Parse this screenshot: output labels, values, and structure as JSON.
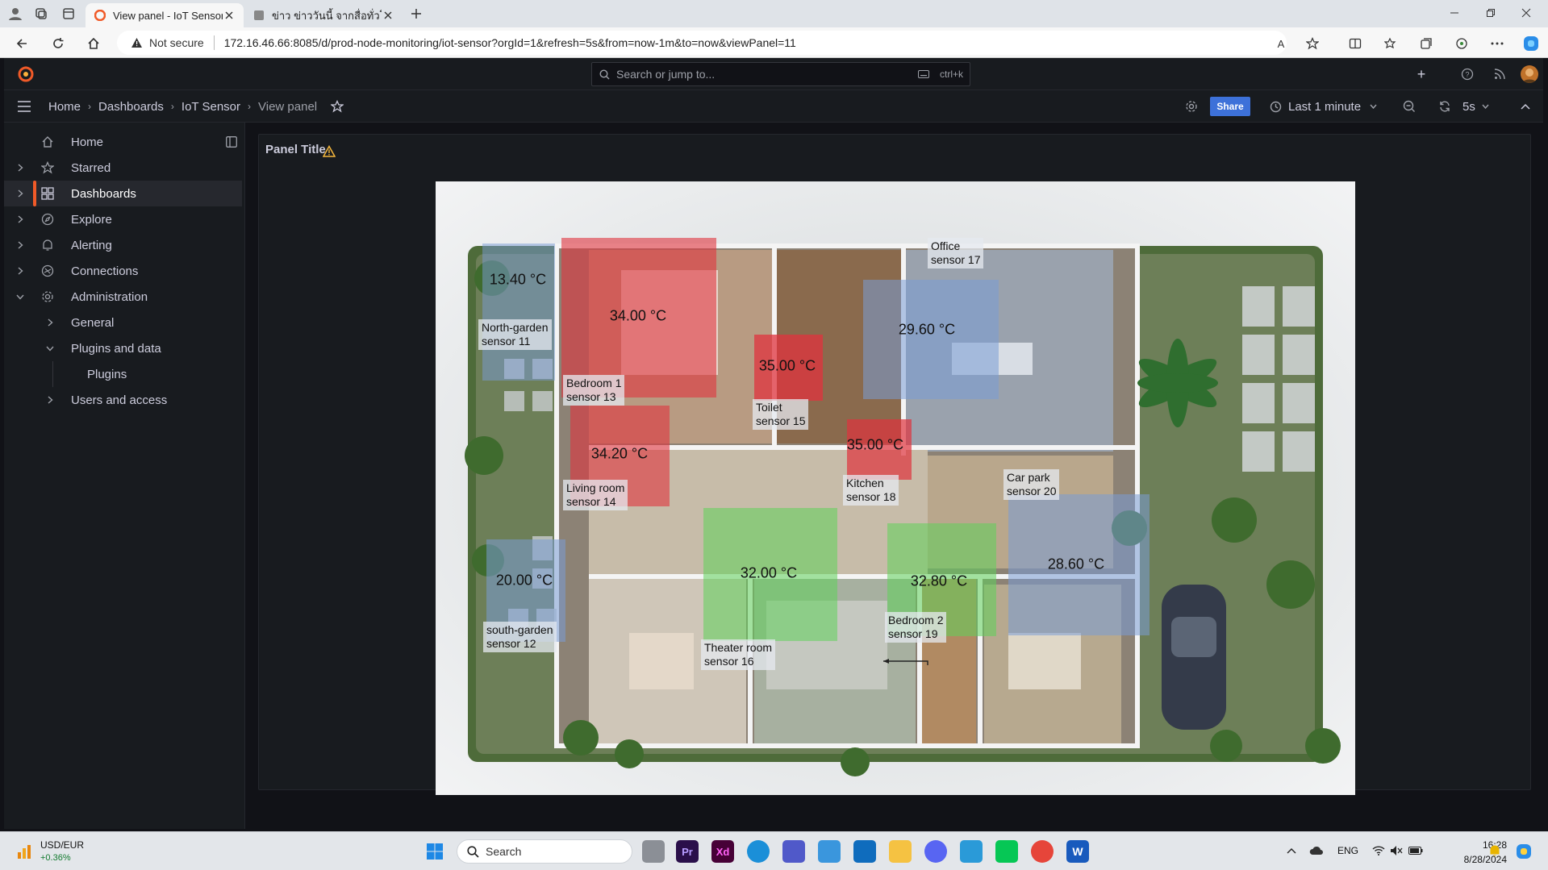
{
  "browser": {
    "tabs": [
      {
        "title": "View panel - IoT Sensor - Dashbo",
        "active": true
      },
      {
        "title": "ข่าว ข่าววันนี้ จากสื่อทั่วโลก ผลบอลโลก",
        "active": false
      }
    ],
    "security_label": "Not secure",
    "url": "172.16.46.66:8085/d/prod-node-monitoring/iot-sensor?orgId=1&refresh=5s&from=now-1m&to=now&viewPanel=11"
  },
  "grafana": {
    "search_placeholder": "Search or jump to...",
    "search_shortcut": "ctrl+k",
    "breadcrumb": [
      "Home",
      "Dashboards",
      "IoT Sensor",
      "View panel"
    ],
    "share_label": "Share",
    "time_range": "Last 1 minute",
    "refresh_interval": "5s",
    "accent": "#f05a28",
    "share_color": "#3d71d9"
  },
  "sidebar": {
    "items": [
      {
        "label": "Home",
        "icon": "home-icon"
      },
      {
        "label": "Starred",
        "icon": "star-icon"
      },
      {
        "label": "Dashboards",
        "icon": "apps-icon",
        "active": true
      },
      {
        "label": "Explore",
        "icon": "compass-icon"
      },
      {
        "label": "Alerting",
        "icon": "bell-icon"
      },
      {
        "label": "Connections",
        "icon": "connections-icon"
      },
      {
        "label": "Administration",
        "icon": "cog-icon",
        "expanded": true
      },
      {
        "label": "General"
      },
      {
        "label": "Plugins and data",
        "expanded": true
      },
      {
        "label": "Plugins"
      },
      {
        "label": "Users and access"
      }
    ]
  },
  "panel": {
    "title": "Panel Title",
    "rooms": [
      {
        "name": "North-garden",
        "sensor": "sensor 11",
        "temp": "13.40 °C",
        "color": "#7a9cd6"
      },
      {
        "name": "south-garden",
        "sensor": "sensor 12",
        "temp": "20.00 °C",
        "color": "#7a9cd6"
      },
      {
        "name": "Bedroom 1",
        "sensor": "sensor 13",
        "temp": "34.00 °C",
        "color": "#e0333d"
      },
      {
        "name": "Living room",
        "sensor": "sensor 14",
        "temp": "34.20 °C",
        "color": "#e0333d"
      },
      {
        "name": "Toilet",
        "sensor": "sensor 15",
        "temp": "35.00 °C",
        "color": "#e0333d"
      },
      {
        "name": "Theater room",
        "sensor": "sensor 16",
        "temp": "32.00 °C",
        "color": "#5ed15a"
      },
      {
        "name": "Office",
        "sensor": "sensor 17",
        "temp": "29.60 °C",
        "color": "#7a9cd6"
      },
      {
        "name": "Kitchen",
        "sensor": "sensor 18",
        "temp": "35.00 °C",
        "color": "#e0333d"
      },
      {
        "name": "Bedroom 2",
        "sensor": "sensor 19",
        "temp": "32.80 °C",
        "color": "#5ed15a"
      },
      {
        "name": "Car park",
        "sensor": "sensor 20",
        "temp": "28.60 °C",
        "color": "#7a9cd6"
      }
    ]
  },
  "taskbar": {
    "weather_label": "USD/EUR",
    "weather_value": "+0.36%",
    "search_label": "Search",
    "lang": "ENG",
    "time": "16:28",
    "date": "8/28/2024"
  }
}
